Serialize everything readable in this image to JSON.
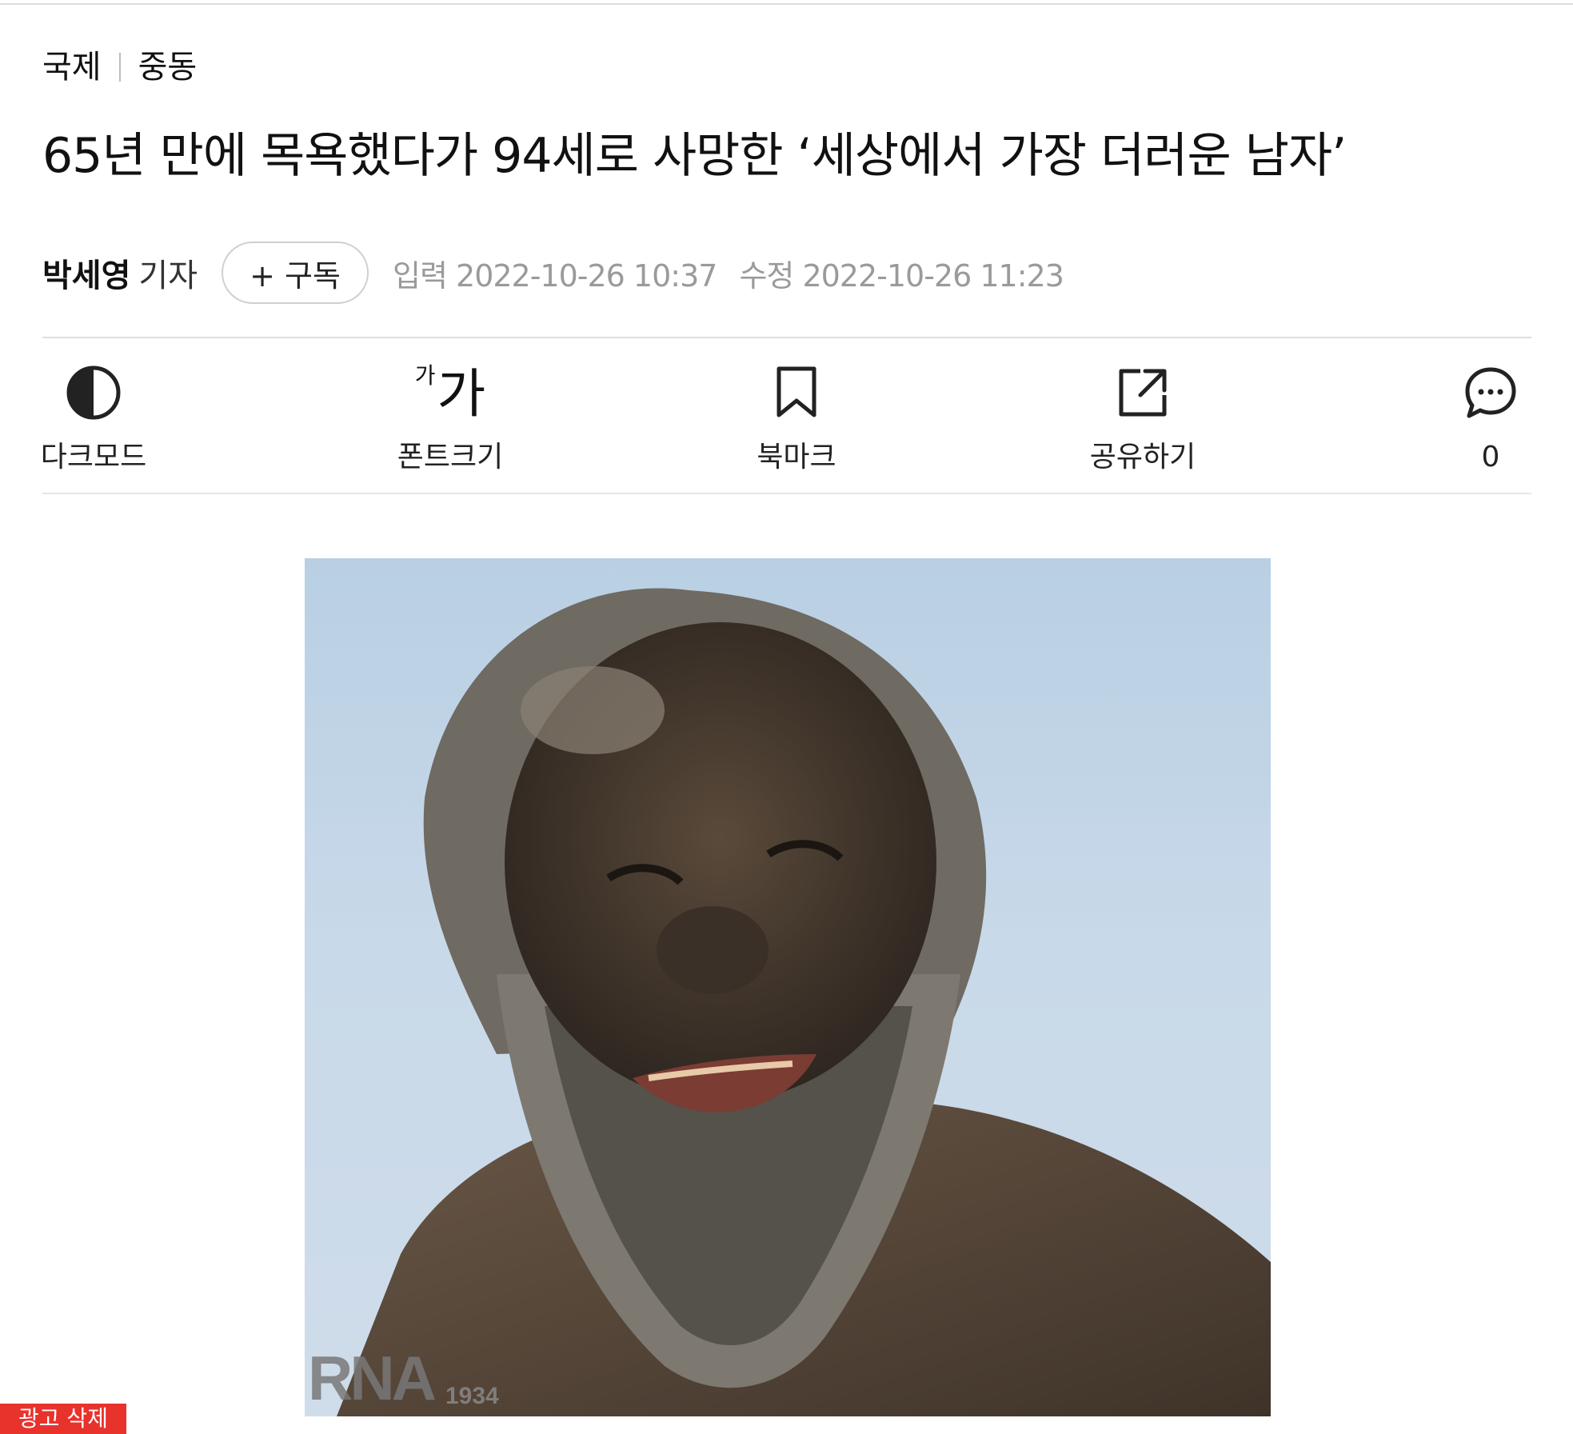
{
  "breadcrumb": {
    "section": "국제",
    "subsection": "중동"
  },
  "article": {
    "title": "65년 만에 목욕했다가 94세로 사망한 ‘세상에서 가장 더러운 남자’",
    "reporter_name": "박세영",
    "reporter_role": "기자",
    "subscribe_label": "+ 구독",
    "input_date": "입력 2022-10-26 10:37",
    "modified_date": "수정 2022-10-26 11:23"
  },
  "toolbar": {
    "darkmode_label": "다크모드",
    "font_small_glyph": "가",
    "font_big_glyph": "가",
    "fontsize_label": "폰트크기",
    "bookmark_label": "북마크",
    "share_label": "공유하기",
    "comment_count": "0"
  },
  "photo": {
    "watermark": "RNA",
    "watermark_year": "1934"
  },
  "ad": {
    "delete_label": "광고 삭제"
  }
}
